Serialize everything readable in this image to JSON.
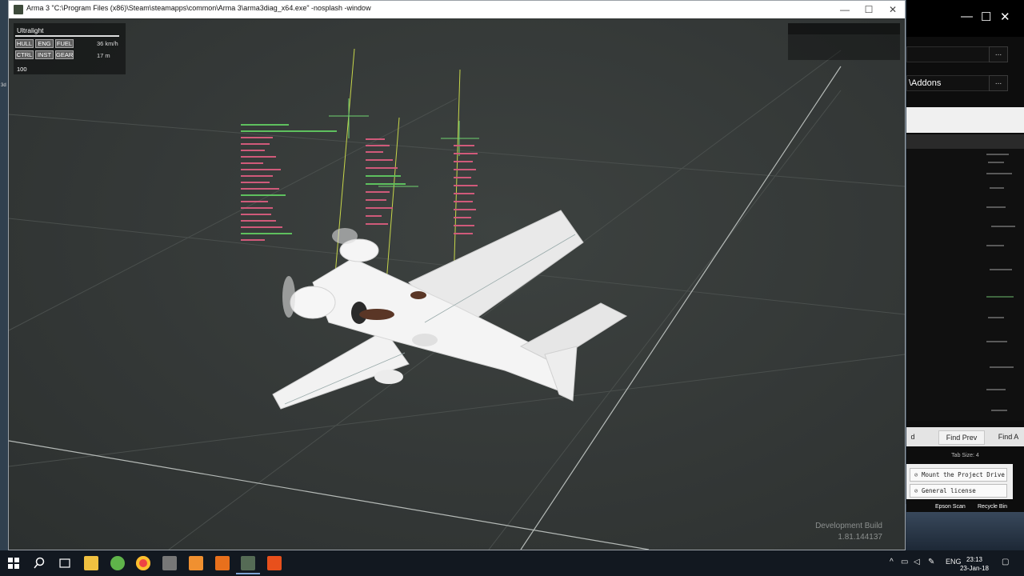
{
  "arma_window": {
    "title": "Arma 3 \"C:\\Program Files (x86)\\Steam\\steamapps\\common\\Arma 3\\arma3diag_x64.exe\" -nosplash -window",
    "minimize": "—",
    "maximize": "☐",
    "close": "✕"
  },
  "hud": {
    "vehicle_name": "Ultralight",
    "buttons": [
      "HULL",
      "ENG",
      "FUEL",
      "CTRL",
      "INST",
      "GEAR"
    ],
    "speed": "36 km/h",
    "altitude": "17 m",
    "throttle": "100"
  },
  "dev_build": {
    "label": "Development Build",
    "version": "1.81.144137"
  },
  "background_app": {
    "minimize": "—",
    "maximize": "☐",
    "close": "✕",
    "path_field_2": "\\Addons",
    "browse": "...",
    "find_prev": "Find Prev",
    "find_all": "Find A",
    "find_left": "d",
    "tab_size": "Tab Size: 4",
    "tools": [
      "Mount the Project Drive",
      "General license"
    ]
  },
  "desktop_icons": [
    "Epson Scan",
    "Recycle Bin"
  ],
  "taskbar": {
    "lang": "ENG",
    "time": "23:13",
    "date": "23-Jan-18"
  }
}
